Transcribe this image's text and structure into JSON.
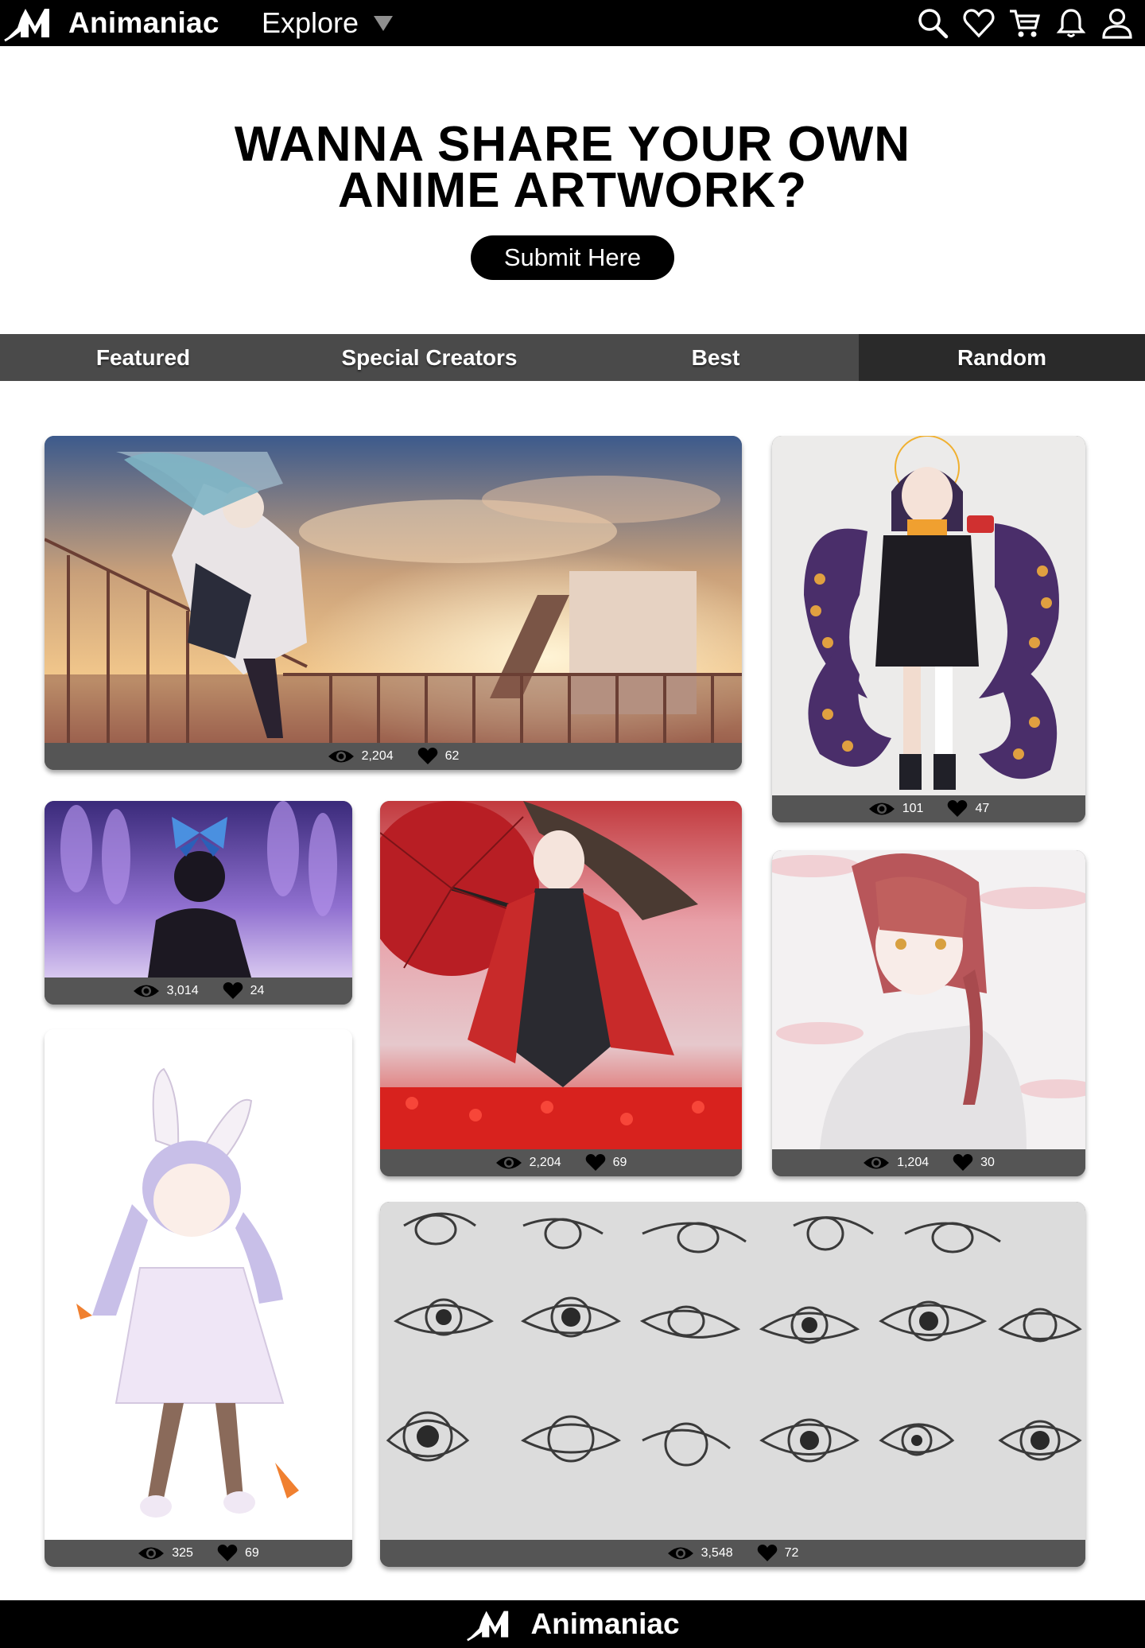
{
  "app": {
    "name": "Animaniac"
  },
  "nav": {
    "explore_label": "Explore",
    "icons": [
      "search-icon",
      "heart-icon",
      "cart-icon",
      "bell-icon",
      "user-icon"
    ]
  },
  "hero": {
    "line1": "WANNA SHARE YOUR OWN",
    "line2": "ANIME ARTWORK?",
    "button_label": "Submit Here"
  },
  "tabs": [
    {
      "label": "Featured",
      "active": false
    },
    {
      "label": "Special Creators",
      "active": false
    },
    {
      "label": "Best",
      "active": false
    },
    {
      "label": "Random",
      "active": true
    }
  ],
  "gallery": [
    {
      "subject": "vocaloid girl on rooftop at sunset",
      "views": "2,204",
      "likes": "62"
    },
    {
      "subject": "octopus tentacle girl",
      "views": "101",
      "likes": "47"
    },
    {
      "subject": "butterfly boy in wisteria",
      "views": "3,014",
      "likes": "24"
    },
    {
      "subject": "fox girl with red umbrella",
      "views": "2,204",
      "likes": "69"
    },
    {
      "subject": "braided red-haired woman",
      "views": "1,204",
      "likes": "30"
    },
    {
      "subject": "bunny girl with carrots",
      "views": "325",
      "likes": "69"
    },
    {
      "subject": "pencil eye sketches",
      "views": "3,548",
      "likes": "72"
    }
  ],
  "footer": {
    "brand": "Animaniac"
  },
  "colors": {
    "nav_bg": "#000000",
    "tab_bg": "#4a4a4a",
    "tab_active_bg": "#2a2a2a",
    "card_bar": "#555555"
  }
}
